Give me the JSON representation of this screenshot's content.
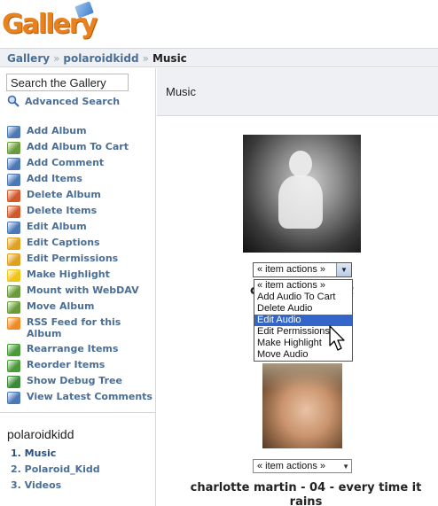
{
  "logo": {
    "text": "Gallery"
  },
  "breadcrumb": {
    "items": [
      "Gallery",
      "polaroidkidd"
    ],
    "separator": "»",
    "current": "Music"
  },
  "sidebar": {
    "search_value": "Search the Gallery",
    "advanced_search": "Advanced Search",
    "actions": [
      {
        "label": "Add Album",
        "icon": "add-album-icon",
        "color": "#4c78b8"
      },
      {
        "label": "Add Album To Cart",
        "icon": "cart-icon",
        "color": "#6a9b3a"
      },
      {
        "label": "Add Comment",
        "icon": "comment-icon",
        "color": "#4c78b8"
      },
      {
        "label": "Add Items",
        "icon": "add-items-icon",
        "color": "#4c78b8"
      },
      {
        "label": "Delete Album",
        "icon": "delete-album-icon",
        "color": "#d0582a"
      },
      {
        "label": "Delete Items",
        "icon": "delete-items-icon",
        "color": "#d0582a"
      },
      {
        "label": "Edit Album",
        "icon": "edit-album-icon",
        "color": "#4c78b8"
      },
      {
        "label": "Edit Captions",
        "icon": "edit-captions-icon",
        "color": "#e0a020"
      },
      {
        "label": "Edit Permissions",
        "icon": "permissions-icon",
        "color": "#e0a020"
      },
      {
        "label": "Make Highlight",
        "icon": "lightbulb-icon",
        "color": "#f0c419"
      },
      {
        "label": "Mount with WebDAV",
        "icon": "webdav-icon",
        "color": "#6a9b3a"
      },
      {
        "label": "Move Album",
        "icon": "move-album-icon",
        "color": "#6a9b3a"
      },
      {
        "label": "RSS Feed for this Album",
        "icon": "rss-icon",
        "color": "#f08a24"
      },
      {
        "label": "Rearrange Items",
        "icon": "rearrange-icon",
        "color": "#4a9a3a"
      },
      {
        "label": "Reorder Items",
        "icon": "reorder-icon",
        "color": "#4a9a3a"
      },
      {
        "label": "Show Debug Tree",
        "icon": "debug-tree-icon",
        "color": "#3a8a3a"
      },
      {
        "label": "View Latest Comments",
        "icon": "comments-icon",
        "color": "#4c78b8"
      }
    ],
    "album_owner": "polaroidkidd",
    "albums": [
      "1. Music",
      "2. Polaroid_Kidd",
      "3. Videos"
    ]
  },
  "main": {
    "title": "Music",
    "item1": {
      "select_value": "« item actions »",
      "caption_peek_left": "c",
      "caption_peek_right": "t",
      "options": [
        "« item actions »",
        "Add Audio To Cart",
        "Delete Audio",
        "Edit Audio",
        "Edit Permissions",
        "Make Highlight",
        "Move Audio"
      ],
      "highlighted": "Edit Audio"
    },
    "item2": {
      "select_value": "« item actions »",
      "caption": "charlotte martin - 04 - every time it rains"
    }
  },
  "colors": {
    "link": "#4a6e96",
    "header_bg": "#eef0f3",
    "logo": "#e8821e",
    "highlight": "#3466c9"
  }
}
